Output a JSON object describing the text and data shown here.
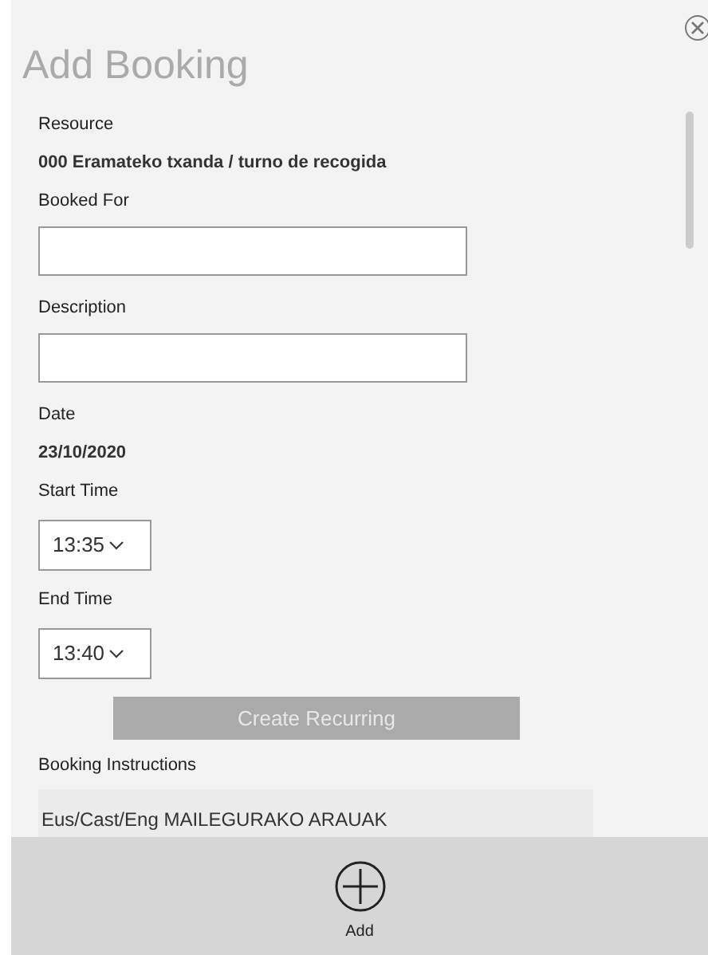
{
  "dialog": {
    "title": "Add Booking"
  },
  "fields": [
    {
      "kind": "value",
      "label": "Resource",
      "value": "000 Eramateko txanda / turno de recogida"
    },
    {
      "kind": "text",
      "label": "Booked For"
    },
    {
      "kind": "text",
      "label": "Description"
    },
    {
      "kind": "value",
      "label": "Date",
      "value": "23/10/2020"
    },
    {
      "kind": "select",
      "label": "Start Time",
      "value": "13:35"
    },
    {
      "kind": "select",
      "label": "End Time",
      "value": "13:40"
    }
  ],
  "recurring_button": {
    "label": "Create Recurring",
    "disabled": true
  },
  "instructions": {
    "label": "Booking Instructions",
    "text": "Eus/Cast/Eng MAILEGURAKO ARAUAK"
  },
  "footer": {
    "add_label": "Add"
  }
}
